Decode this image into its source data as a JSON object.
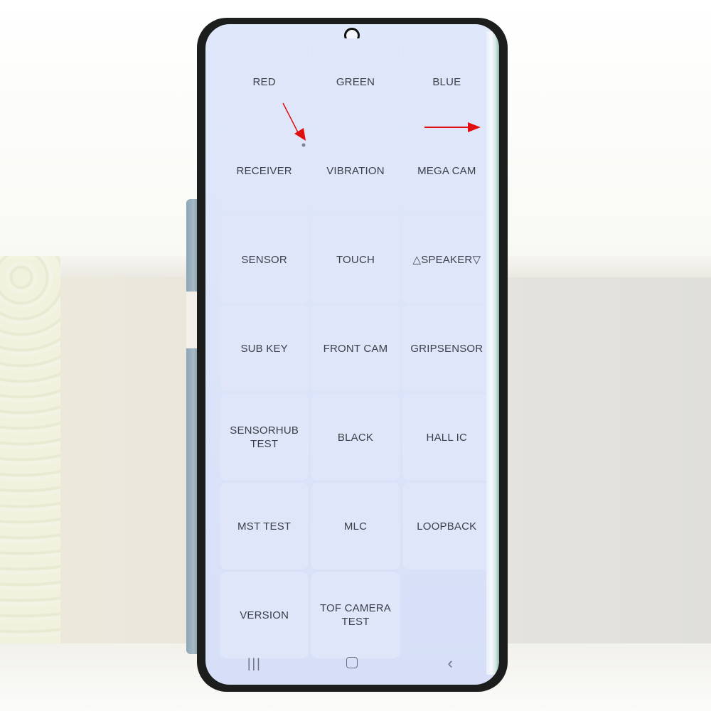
{
  "scene": {
    "description": "Smartphone displaying hardware test menu with red annotation arrows"
  },
  "test_menu": {
    "tiles": [
      {
        "label": "RED"
      },
      {
        "label": "GREEN"
      },
      {
        "label": "BLUE"
      },
      {
        "label": "RECEIVER"
      },
      {
        "label": "VIBRATION"
      },
      {
        "label": "MEGA CAM"
      },
      {
        "label": "SENSOR"
      },
      {
        "label": "TOUCH"
      },
      {
        "label": "△SPEAKER▽"
      },
      {
        "label": "SUB KEY"
      },
      {
        "label": "FRONT CAM"
      },
      {
        "label": "GRIPSENSOR"
      },
      {
        "label": "SENSORHUB\nTEST"
      },
      {
        "label": "BLACK"
      },
      {
        "label": "HALL IC"
      },
      {
        "label": "MST TEST"
      },
      {
        "label": "MLC"
      },
      {
        "label": "LOOPBACK"
      },
      {
        "label": "VERSION"
      },
      {
        "label": "TOF CAMERA\nTEST"
      }
    ]
  },
  "navbar": {
    "recent_icon": "|||",
    "home_icon": "home-icon",
    "back_icon": "‹"
  },
  "colors": {
    "annotation": "#e01010",
    "screen_bg": "#dbe4f9",
    "tile_text": "#3c3f48"
  }
}
